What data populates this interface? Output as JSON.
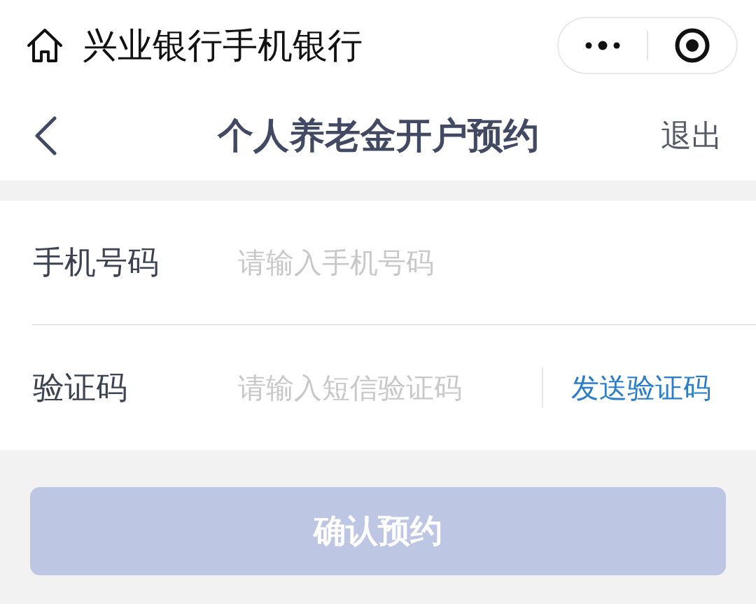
{
  "mini_program_bar": {
    "title": "兴业银行手机银行"
  },
  "nav_bar": {
    "title": "个人养老金开户预约",
    "exit": "退出"
  },
  "form": {
    "fields": [
      {
        "label": "手机号码",
        "placeholder": "请输入手机号码"
      },
      {
        "label": "验证码",
        "placeholder": "请输入短信验证码",
        "action": "发送验证码"
      }
    ]
  },
  "submit": {
    "label": "确认预约",
    "disabled": true
  }
}
